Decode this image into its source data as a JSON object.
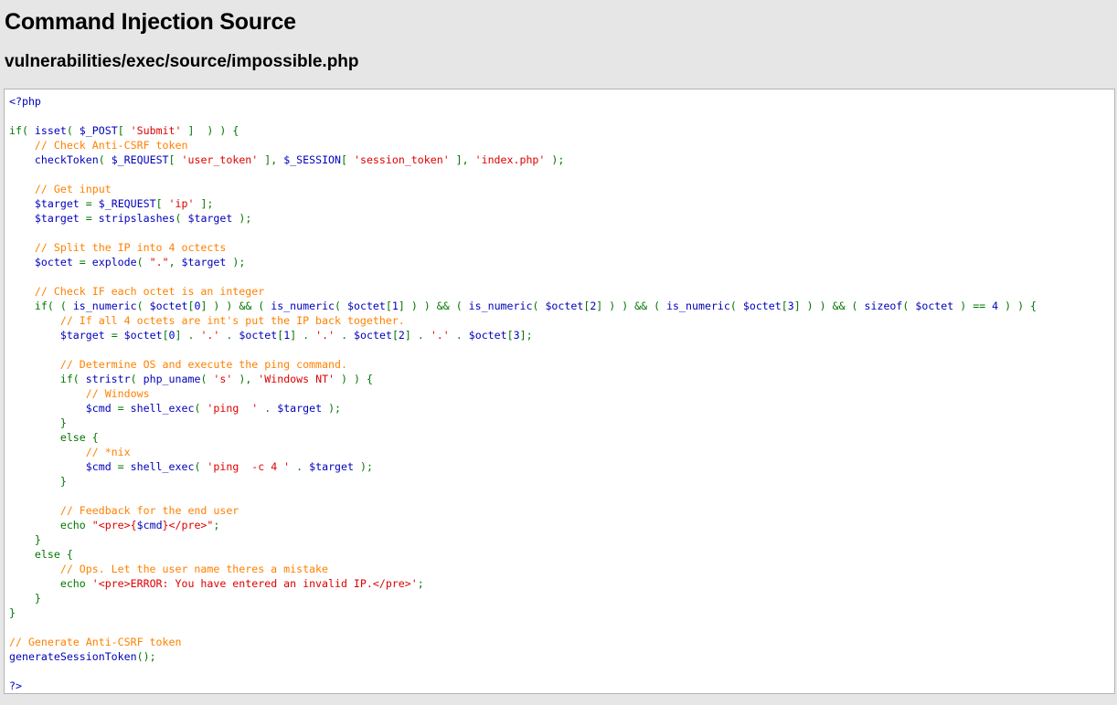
{
  "page": {
    "title": "Command Injection Source",
    "path": "vulnerabilities/exec/source/impossible.php"
  },
  "colors": {
    "default": "#0000BB",
    "keyword": "#007700",
    "string": "#DD0000",
    "comment": "#FF8000",
    "html": "#000000",
    "background": "#E6E6E6"
  },
  "code": {
    "lines": [
      [
        [
          "default",
          "<?php"
        ]
      ],
      [],
      [
        [
          "keyword",
          "if( "
        ],
        [
          "default",
          "isset"
        ],
        [
          "keyword",
          "( "
        ],
        [
          "default",
          "$_POST"
        ],
        [
          "keyword",
          "[ "
        ],
        [
          "string",
          "'Submit'"
        ],
        [
          "keyword",
          " ]  ) ) {"
        ]
      ],
      [
        [
          "comment",
          "    // Check Anti-CSRF token"
        ]
      ],
      [
        [
          "keyword",
          "    "
        ],
        [
          "default",
          "checkToken"
        ],
        [
          "keyword",
          "( "
        ],
        [
          "default",
          "$_REQUEST"
        ],
        [
          "keyword",
          "[ "
        ],
        [
          "string",
          "'user_token'"
        ],
        [
          "keyword",
          " ], "
        ],
        [
          "default",
          "$_SESSION"
        ],
        [
          "keyword",
          "[ "
        ],
        [
          "string",
          "'session_token'"
        ],
        [
          "keyword",
          " ], "
        ],
        [
          "string",
          "'index.php'"
        ],
        [
          "keyword",
          " );"
        ]
      ],
      [],
      [
        [
          "comment",
          "    // Get input"
        ]
      ],
      [
        [
          "keyword",
          "    "
        ],
        [
          "default",
          "$target"
        ],
        [
          "keyword",
          " = "
        ],
        [
          "default",
          "$_REQUEST"
        ],
        [
          "keyword",
          "[ "
        ],
        [
          "string",
          "'ip'"
        ],
        [
          "keyword",
          " ];"
        ]
      ],
      [
        [
          "keyword",
          "    "
        ],
        [
          "default",
          "$target"
        ],
        [
          "keyword",
          " = "
        ],
        [
          "default",
          "stripslashes"
        ],
        [
          "keyword",
          "( "
        ],
        [
          "default",
          "$target"
        ],
        [
          "keyword",
          " );"
        ]
      ],
      [],
      [
        [
          "comment",
          "    // Split the IP into 4 octects"
        ]
      ],
      [
        [
          "keyword",
          "    "
        ],
        [
          "default",
          "$octet"
        ],
        [
          "keyword",
          " = "
        ],
        [
          "default",
          "explode"
        ],
        [
          "keyword",
          "( "
        ],
        [
          "string",
          "\".\""
        ],
        [
          "keyword",
          ", "
        ],
        [
          "default",
          "$target"
        ],
        [
          "keyword",
          " );"
        ]
      ],
      [],
      [
        [
          "comment",
          "    // Check IF each octet is an integer"
        ]
      ],
      [
        [
          "keyword",
          "    if( ( "
        ],
        [
          "default",
          "is_numeric"
        ],
        [
          "keyword",
          "( "
        ],
        [
          "default",
          "$octet"
        ],
        [
          "keyword",
          "["
        ],
        [
          "default",
          "0"
        ],
        [
          "keyword",
          "] ) ) && ( "
        ],
        [
          "default",
          "is_numeric"
        ],
        [
          "keyword",
          "( "
        ],
        [
          "default",
          "$octet"
        ],
        [
          "keyword",
          "["
        ],
        [
          "default",
          "1"
        ],
        [
          "keyword",
          "] ) ) && ( "
        ],
        [
          "default",
          "is_numeric"
        ],
        [
          "keyword",
          "( "
        ],
        [
          "default",
          "$octet"
        ],
        [
          "keyword",
          "["
        ],
        [
          "default",
          "2"
        ],
        [
          "keyword",
          "] ) ) && ( "
        ],
        [
          "default",
          "is_numeric"
        ],
        [
          "keyword",
          "( "
        ],
        [
          "default",
          "$octet"
        ],
        [
          "keyword",
          "["
        ],
        [
          "default",
          "3"
        ],
        [
          "keyword",
          "] ) ) && ( "
        ],
        [
          "default",
          "sizeof"
        ],
        [
          "keyword",
          "( "
        ],
        [
          "default",
          "$octet"
        ],
        [
          "keyword",
          " ) == "
        ],
        [
          "default",
          "4"
        ],
        [
          "keyword",
          " ) ) {"
        ]
      ],
      [
        [
          "comment",
          "        // If all 4 octets are int's put the IP back together."
        ]
      ],
      [
        [
          "keyword",
          "        "
        ],
        [
          "default",
          "$target"
        ],
        [
          "keyword",
          " = "
        ],
        [
          "default",
          "$octet"
        ],
        [
          "keyword",
          "["
        ],
        [
          "default",
          "0"
        ],
        [
          "keyword",
          "] . "
        ],
        [
          "string",
          "'.'"
        ],
        [
          "keyword",
          " . "
        ],
        [
          "default",
          "$octet"
        ],
        [
          "keyword",
          "["
        ],
        [
          "default",
          "1"
        ],
        [
          "keyword",
          "] . "
        ],
        [
          "string",
          "'.'"
        ],
        [
          "keyword",
          " . "
        ],
        [
          "default",
          "$octet"
        ],
        [
          "keyword",
          "["
        ],
        [
          "default",
          "2"
        ],
        [
          "keyword",
          "] . "
        ],
        [
          "string",
          "'.'"
        ],
        [
          "keyword",
          " . "
        ],
        [
          "default",
          "$octet"
        ],
        [
          "keyword",
          "["
        ],
        [
          "default",
          "3"
        ],
        [
          "keyword",
          "];"
        ]
      ],
      [],
      [
        [
          "comment",
          "        // Determine OS and execute the ping command."
        ]
      ],
      [
        [
          "keyword",
          "        if( "
        ],
        [
          "default",
          "stristr"
        ],
        [
          "keyword",
          "( "
        ],
        [
          "default",
          "php_uname"
        ],
        [
          "keyword",
          "( "
        ],
        [
          "string",
          "'s'"
        ],
        [
          "keyword",
          " ), "
        ],
        [
          "string",
          "'Windows NT'"
        ],
        [
          "keyword",
          " ) ) {"
        ]
      ],
      [
        [
          "comment",
          "            // Windows"
        ]
      ],
      [
        [
          "keyword",
          "            "
        ],
        [
          "default",
          "$cmd"
        ],
        [
          "keyword",
          " = "
        ],
        [
          "default",
          "shell_exec"
        ],
        [
          "keyword",
          "( "
        ],
        [
          "string",
          "'ping  '"
        ],
        [
          "keyword",
          " . "
        ],
        [
          "default",
          "$target"
        ],
        [
          "keyword",
          " );"
        ]
      ],
      [
        [
          "keyword",
          "        }"
        ]
      ],
      [
        [
          "keyword",
          "        else {"
        ]
      ],
      [
        [
          "comment",
          "            // *nix"
        ]
      ],
      [
        [
          "keyword",
          "            "
        ],
        [
          "default",
          "$cmd"
        ],
        [
          "keyword",
          " = "
        ],
        [
          "default",
          "shell_exec"
        ],
        [
          "keyword",
          "( "
        ],
        [
          "string",
          "'ping  -c 4 '"
        ],
        [
          "keyword",
          " . "
        ],
        [
          "default",
          "$target"
        ],
        [
          "keyword",
          " );"
        ]
      ],
      [
        [
          "keyword",
          "        }"
        ]
      ],
      [],
      [
        [
          "comment",
          "        // Feedback for the end user"
        ]
      ],
      [
        [
          "keyword",
          "        echo "
        ],
        [
          "string",
          "\"<pre>{"
        ],
        [
          "default",
          "$cmd"
        ],
        [
          "string",
          "}</pre>\""
        ],
        [
          "keyword",
          ";"
        ]
      ],
      [
        [
          "keyword",
          "    }"
        ]
      ],
      [
        [
          "keyword",
          "    else {"
        ]
      ],
      [
        [
          "comment",
          "        // Ops. Let the user name theres a mistake"
        ]
      ],
      [
        [
          "keyword",
          "        echo "
        ],
        [
          "string",
          "'<pre>ERROR: You have entered an invalid IP.</pre>'"
        ],
        [
          "keyword",
          ";"
        ]
      ],
      [
        [
          "keyword",
          "    }"
        ]
      ],
      [
        [
          "keyword",
          "}"
        ]
      ],
      [],
      [
        [
          "comment",
          "// Generate Anti-CSRF token"
        ]
      ],
      [
        [
          "default",
          "generateSessionToken"
        ],
        [
          "keyword",
          "();"
        ]
      ],
      [],
      [
        [
          "default",
          "?>"
        ]
      ]
    ]
  }
}
